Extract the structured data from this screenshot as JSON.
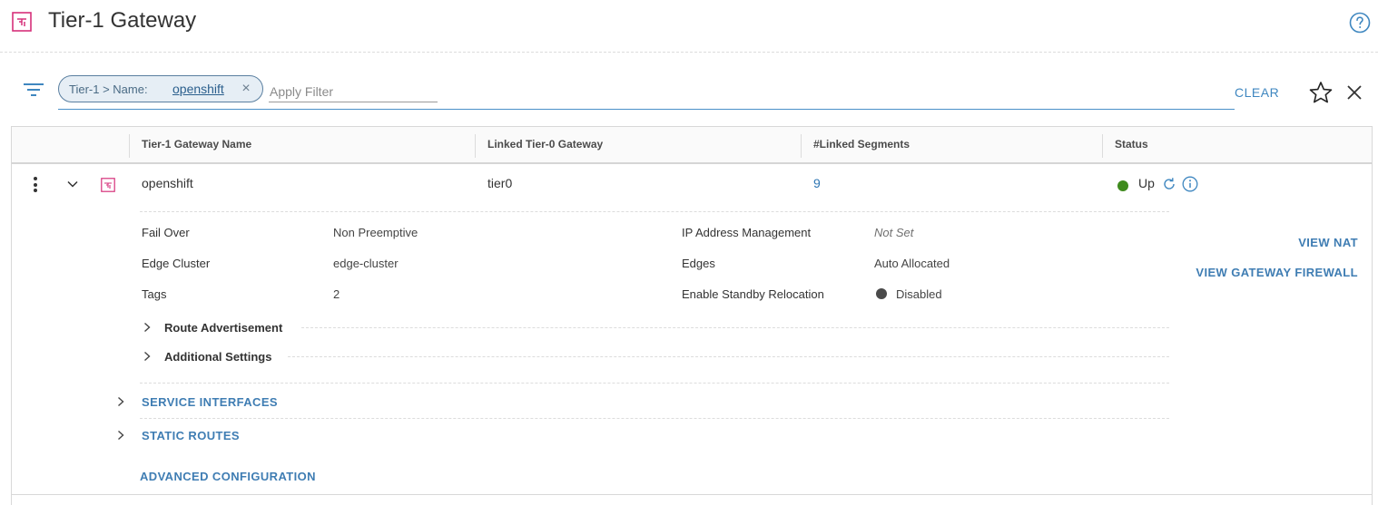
{
  "header": {
    "title": "Tier-1 Gateway",
    "icon": "tier1-gateway-icon",
    "help_icon": "help-circle-icon"
  },
  "filter": {
    "chip_label": "Tier-1 > Name:",
    "chip_value": "openshift",
    "input_placeholder": "Apply Filter",
    "clear_label": "CLEAR"
  },
  "grid": {
    "columns": [
      "Tier-1 Gateway Name",
      "Linked Tier-0 Gateway",
      "#Linked Segments",
      "Status"
    ],
    "row": {
      "name": "openshift",
      "linked_tier0": "tier0",
      "linked_segments": "9",
      "status": "Up",
      "status_color": "#3f8b1e"
    },
    "details": {
      "fail_over_label": "Fail Over",
      "fail_over_value": "Non Preemptive",
      "edge_cluster_label": "Edge Cluster",
      "edge_cluster_value": "edge-cluster",
      "tags_label": "Tags",
      "tags_value": "2",
      "ip_mgmt_label": "IP Address Management",
      "ip_mgmt_value": "Not Set",
      "edges_label": "Edges",
      "edges_value": "Auto Allocated",
      "standby_label": "Enable Standby Relocation",
      "standby_value": "Disabled",
      "route_adv": "Route Advertisement",
      "additional_settings": "Additional Settings",
      "service_interfaces": "SERVICE INTERFACES",
      "static_routes": "STATIC ROUTES",
      "advanced_config": "ADVANCED CONFIGURATION",
      "view_nat": "VIEW NAT",
      "view_firewall": "VIEW GATEWAY FIREWALL"
    }
  },
  "colors": {
    "accent": "#3f87c0",
    "link": "#2e76b3",
    "icon_pink": "#d6307a"
  }
}
